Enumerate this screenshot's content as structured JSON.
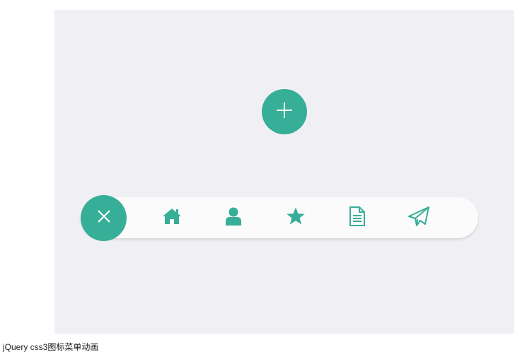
{
  "caption": "jQuery css3图标菜单动画",
  "colors": {
    "accent": "#37ae97",
    "stage_background": "#f0f0f4",
    "menu_background": "#fbfbfb",
    "icon_color": "#37ae97"
  },
  "open_button": {
    "icon": "plus-icon"
  },
  "menu": {
    "close_button": {
      "icon": "close-icon"
    },
    "items": [
      {
        "icon": "home-icon"
      },
      {
        "icon": "user-icon"
      },
      {
        "icon": "star-icon"
      },
      {
        "icon": "document-icon"
      },
      {
        "icon": "paper-plane-icon"
      }
    ]
  }
}
